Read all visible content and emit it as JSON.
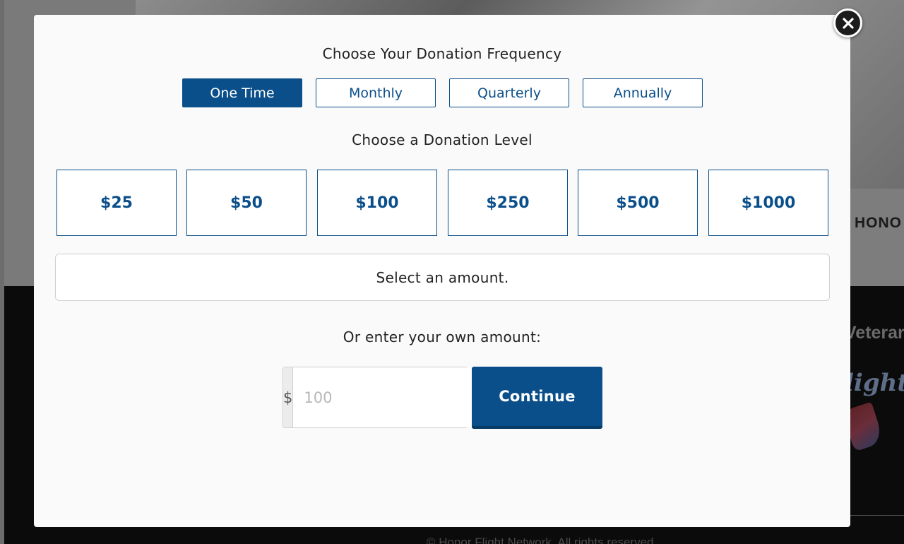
{
  "background": {
    "honor_text": "HONO",
    "veteran_text": "Veterar",
    "logo_text": "light",
    "copyright": "© Honor Flight Network. All rights reserved"
  },
  "modal": {
    "close_icon": "close-x-icon",
    "frequency_title": "Choose Your Donation Frequency",
    "frequency_options": [
      "One Time",
      "Monthly",
      "Quarterly",
      "Annually"
    ],
    "selected_frequency": "One Time",
    "level_title": "Choose a Donation Level",
    "levels": [
      "$25",
      "$50",
      "$100",
      "$250",
      "$500",
      "$1000"
    ],
    "status_message": "Select an amount.",
    "custom_amount_title": "Or enter your own amount:",
    "currency_symbol": "$",
    "amount_placeholder": "100",
    "amount_value": "",
    "continue_label": "Continue"
  },
  "colors": {
    "primary": "#0b4f8a",
    "modal_bg": "#fafafa",
    "overlay_dark": "#0b0b0b"
  }
}
